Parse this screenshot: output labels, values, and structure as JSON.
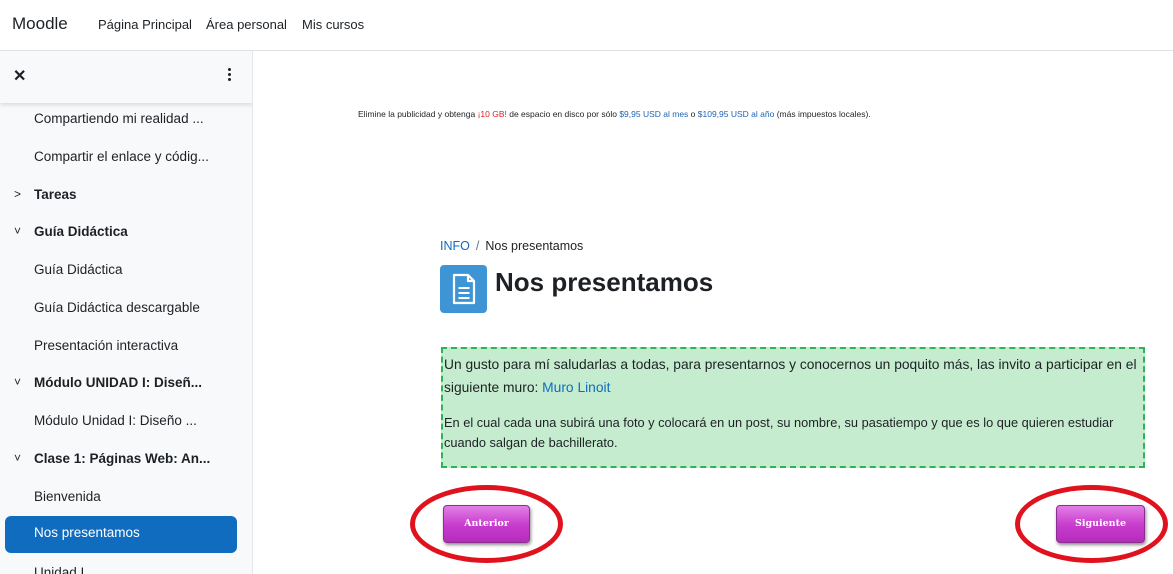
{
  "navbar": {
    "brand": "Moodle",
    "links": [
      "Página Principal",
      "Área personal",
      "Mis cursos"
    ]
  },
  "drawer": {
    "close_icon": "close-icon",
    "menu_icon": "kebab-menu-icon",
    "items": [
      {
        "label": "Compartiendo mi realidad ...",
        "type": "activity"
      },
      {
        "label": "Compartir el enlace y códig...",
        "type": "activity"
      },
      {
        "label": "Tareas",
        "type": "section",
        "chevron": ">"
      },
      {
        "label": "Guía Didáctica",
        "type": "section",
        "chevron": "˅"
      },
      {
        "label": "Guía Didáctica",
        "type": "activity"
      },
      {
        "label": "Guía Didáctica descargable",
        "type": "activity"
      },
      {
        "label": "Presentación interactiva",
        "type": "activity"
      },
      {
        "label": "Módulo UNIDAD I: Diseñ...",
        "type": "section",
        "chevron": "˅"
      },
      {
        "label": "Módulo Unidad I: Diseño ...",
        "type": "activity"
      },
      {
        "label": "Clase 1: Páginas Web: An...",
        "type": "section",
        "chevron": "˅"
      },
      {
        "label": "Bienvenida",
        "type": "activity"
      },
      {
        "label": "Nos presentamos",
        "type": "activity",
        "active": true
      },
      {
        "label": "Unidad I",
        "type": "activity"
      }
    ]
  },
  "ad": {
    "text1": "Elimine la publicidad y obtenga ",
    "highlight1": "¡10 GB!",
    "text2": " de espacio en disco por sólo ",
    "price_month": "$9,95 USD al mes",
    "text3": " o ",
    "price_year": "$109,95 USD al año",
    "text4": " (más impuestos locales)."
  },
  "breadcrumb": {
    "parent": "INFO",
    "separator": "/",
    "current": "Nos presentamos"
  },
  "page": {
    "icon": "page-document-icon",
    "title": "Nos presentamos",
    "paragraph1": "Un gusto para mí saludarlas a todas, para presentarnos y conocernos un poquito más, las invito a participar en el siguiente muro: ",
    "link": "Muro Linoit",
    "paragraph2": " En el cual cada una subirá una foto y colocará en un post, su nombre, su pasatiempo y que es lo que quieren estudiar cuando salgan de bachillerato."
  },
  "navigation": {
    "prev_label": "Anterior",
    "next_label": "Siguiente"
  },
  "colors": {
    "accent": "#0f6cbf",
    "box_background": "#c6eccf",
    "box_border": "#2db35a",
    "button": "#c63bcc",
    "annotation": "#e0121e"
  }
}
